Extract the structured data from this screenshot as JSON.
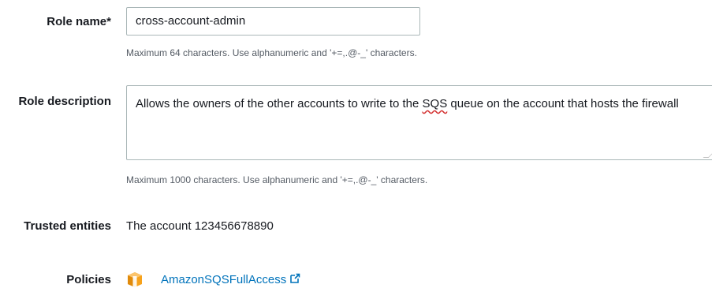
{
  "role_name": {
    "label": "Role name*",
    "value": "cross-account-admin",
    "help": "Maximum 64 characters. Use alphanumeric and '+=,.@-_' characters."
  },
  "role_description": {
    "label": "Role description",
    "value_before": "Allows the  owners of the other accounts to write to the ",
    "value_flagged": "SQS",
    "value_after": " queue on the account that hosts the firewall",
    "help": "Maximum 1000 characters. Use alphanumeric and '+=,.@-_' characters."
  },
  "trusted_entities": {
    "label": "Trusted entities",
    "value": "The account 123456678890"
  },
  "policies": {
    "label": "Policies",
    "items": [
      {
        "name": "AmazonSQSFullAccess",
        "icon": "aws-managed-policy-icon"
      }
    ]
  },
  "colors": {
    "link": "#0073bb",
    "policy_icon": "#f7a21b",
    "input_border": "#aab7b8",
    "help_text": "#545b64",
    "spell_underline": "#d32f2f"
  }
}
